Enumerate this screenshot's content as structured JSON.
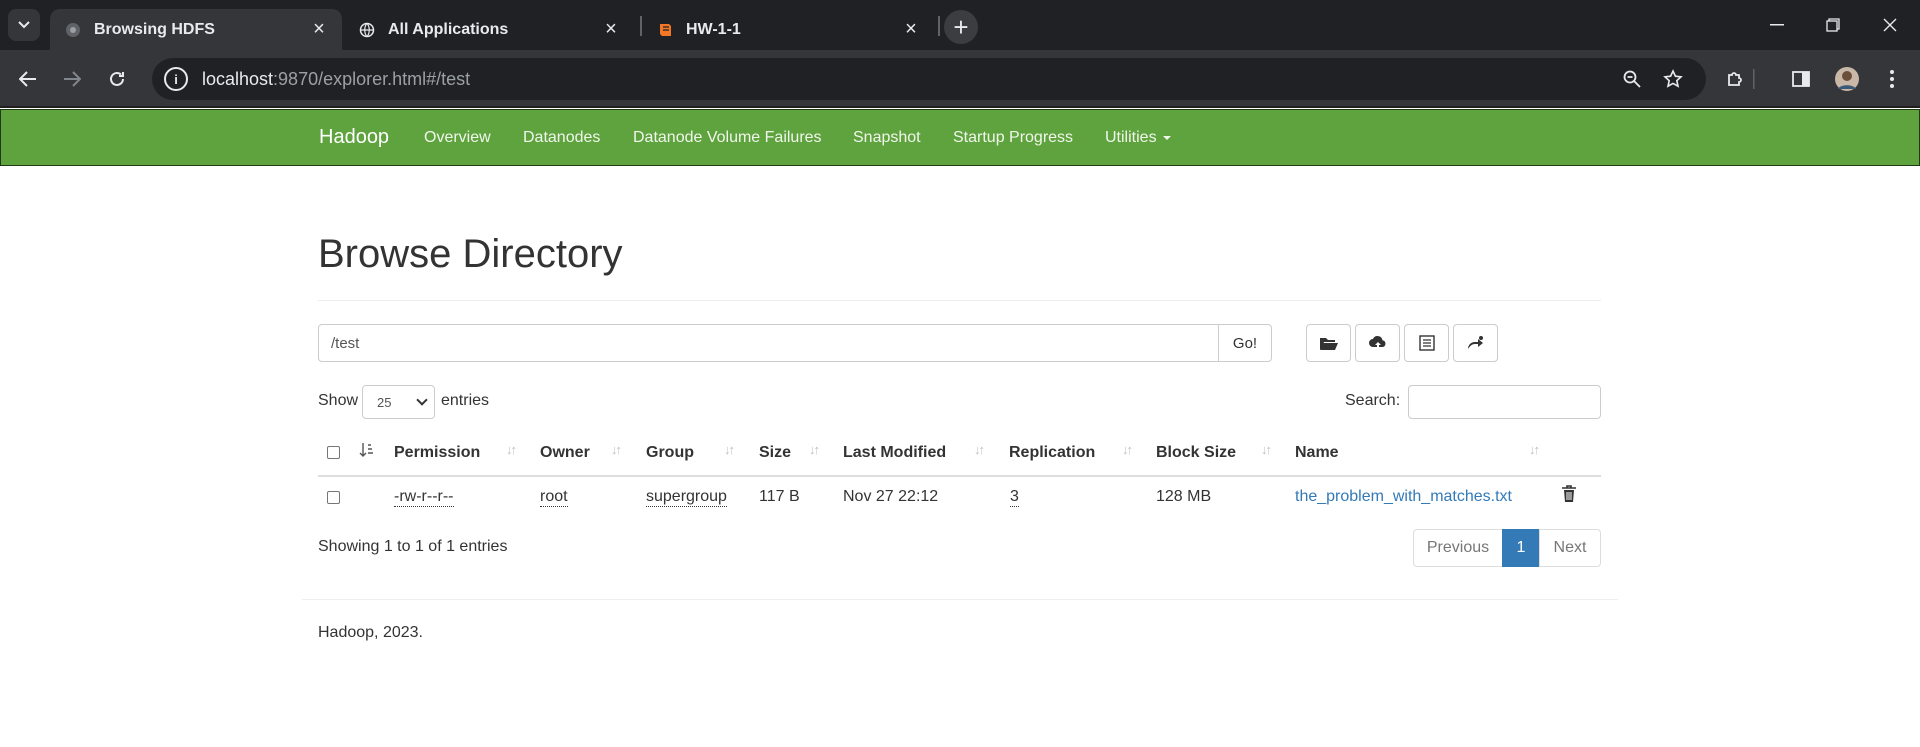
{
  "browser": {
    "tabs": [
      {
        "title": "Browsing HDFS",
        "active": true
      },
      {
        "title": "All Applications",
        "active": false
      },
      {
        "title": "HW-1-1",
        "active": false
      }
    ],
    "url_host": "localhost",
    "url_rest": ":9870/explorer.html#/test"
  },
  "navbar": {
    "brand": "Hadoop",
    "items": [
      "Overview",
      "Datanodes",
      "Datanode Volume Failures",
      "Snapshot",
      "Startup Progress",
      "Utilities"
    ],
    "color": "#5fa33e"
  },
  "main": {
    "title": "Browse Directory",
    "path_value": "/test",
    "go_label": "Go!",
    "show_label": "Show",
    "page_length": "25",
    "entries_label": "entries",
    "search_label": "Search:",
    "columns": [
      "Permission",
      "Owner",
      "Group",
      "Size",
      "Last Modified",
      "Replication",
      "Block Size",
      "Name"
    ],
    "rows": [
      {
        "permission": "-rw-r--r--",
        "owner": "root",
        "group": "supergroup",
        "size": "117 B",
        "last_modified": "Nov 27 22:12",
        "replication": "3",
        "block_size": "128 MB",
        "name": "the_problem_with_matches.txt"
      }
    ],
    "info": "Showing 1 to 1 of 1 entries",
    "pager": {
      "previous": "Previous",
      "current": "1",
      "next": "Next"
    }
  },
  "footer": "Hadoop, 2023.",
  "icons": [
    "folder-open-icon",
    "cloud-upload-icon",
    "list-icon",
    "cut-paste-icon",
    "trash-icon"
  ],
  "link_color": "#337ab7"
}
